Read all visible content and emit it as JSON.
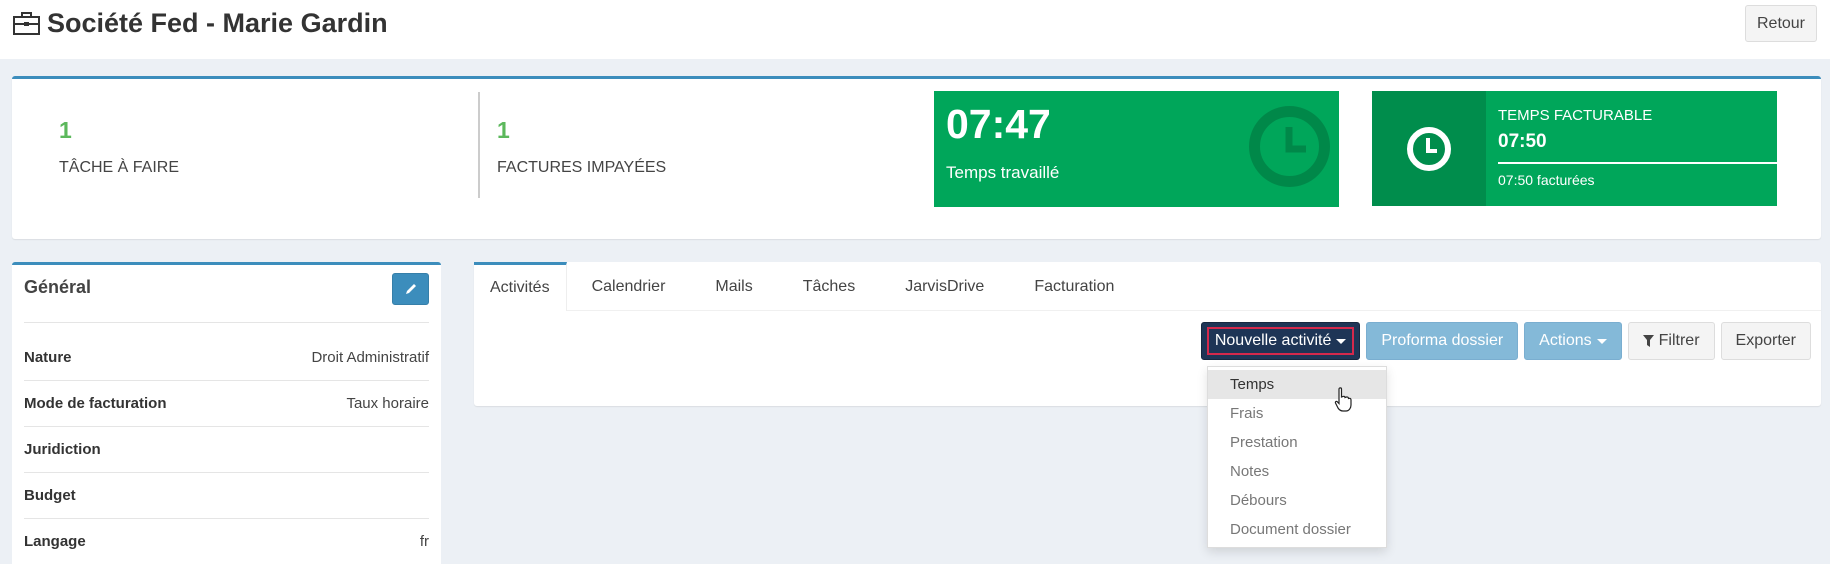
{
  "header": {
    "title": "Société Fed - Marie Gardin",
    "back_label": "Retour"
  },
  "stats": {
    "tasks": {
      "value": "1",
      "label": "TÂCHE À FAIRE"
    },
    "invoices": {
      "value": "1",
      "label": "FACTURES IMPAYÉES"
    },
    "worked": {
      "value": "07:47",
      "label": "Temps travaillé"
    },
    "billable": {
      "title": "TEMPS FACTURABLE",
      "value": "07:50",
      "desc": "07:50 facturées",
      "progress": 1.0
    }
  },
  "general": {
    "title": "Général",
    "rows": [
      {
        "key": "Nature",
        "value": "Droit Administratif"
      },
      {
        "key": "Mode de facturation",
        "value": "Taux horaire"
      },
      {
        "key": "Juridiction",
        "value": ""
      },
      {
        "key": "Budget",
        "value": ""
      },
      {
        "key": "Langage",
        "value": "fr"
      }
    ]
  },
  "tabs": [
    "Activités",
    "Calendrier",
    "Mails",
    "Tâches",
    "JarvisDrive",
    "Facturation"
  ],
  "toolbar": {
    "new_activity": "Nouvelle activité",
    "proforma": "Proforma dossier",
    "actions": "Actions",
    "filter": "Filtrer",
    "export": "Exporter"
  },
  "dropdown": [
    "Temps",
    "Frais",
    "Prestation",
    "Notes",
    "Débours",
    "Document dossier"
  ],
  "colors": {
    "accent": "#3c8dbc",
    "green": "#00a65a",
    "dark_green": "#008d4c",
    "navy": "#1e3556",
    "number_green": "#5cb85c"
  },
  "icons": {
    "title": "briefcase-icon",
    "edit": "pencil-icon",
    "clock": "clock-icon",
    "filter": "filter-icon"
  }
}
